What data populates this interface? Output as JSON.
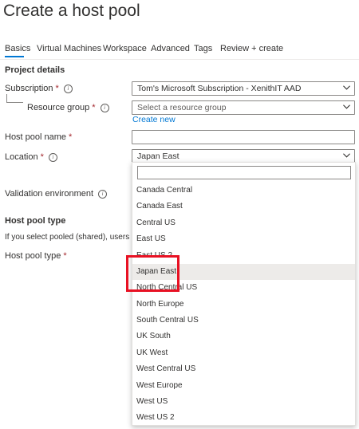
{
  "page": {
    "title": "Create a host pool",
    "more": "···"
  },
  "tabs": [
    "Basics",
    "Virtual Machines",
    "Workspace",
    "Advanced",
    "Tags",
    "Review + create"
  ],
  "project": {
    "section": "Project details",
    "subscription_label": "Subscription",
    "subscription_value": "Tom's Microsoft Subscription - XenithIT AAD",
    "resource_group_label": "Resource group",
    "resource_group_placeholder": "Select a resource group",
    "create_new": "Create new",
    "host_pool_name_label": "Host pool name",
    "location_label": "Location",
    "location_value": "Japan East",
    "validation_label": "Validation environment"
  },
  "host_pool_type": {
    "section": "Host pool type",
    "description": "If you select pooled (shared), users will still l",
    "label": "Host pool type"
  },
  "required_mark": "*",
  "info_glyph": "i",
  "location_dropdown": {
    "search_value": "",
    "selected": "Japan East",
    "options": [
      "Canada Central",
      "Canada East",
      "Central US",
      "East US",
      "East US 2",
      "Japan East",
      "North Central US",
      "North Europe",
      "South Central US",
      "UK South",
      "UK West",
      "West Central US",
      "West Europe",
      "West US",
      "West US 2"
    ]
  }
}
